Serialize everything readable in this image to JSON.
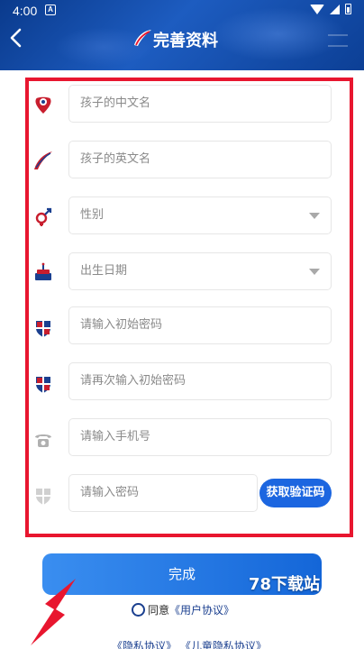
{
  "status": {
    "time": "4:00"
  },
  "header": {
    "title": "完善资料"
  },
  "form": {
    "chinese_name": {
      "placeholder": "孩子的中文名"
    },
    "english_name": {
      "placeholder": "孩子的英文名"
    },
    "gender": {
      "placeholder": "性别"
    },
    "birthday": {
      "placeholder": "出生日期"
    },
    "initial_password": {
      "placeholder": "请输入初始密码"
    },
    "confirm_password": {
      "placeholder": "请再次输入初始密码"
    },
    "phone": {
      "placeholder": "请输入手机号"
    },
    "password": {
      "placeholder": "请输入密码"
    },
    "get_code_label": "获取验证码"
  },
  "submit_label": "完成",
  "watermark": "78下载站",
  "agreement": {
    "prefix": "同意",
    "user_agreement": "《用户协议》"
  },
  "policies": {
    "privacy": "《隐私协议》",
    "child_privacy": "《儿童隐私协议》"
  },
  "colors": {
    "header_blue": "#1d5cc0",
    "accent": "#1c66e0",
    "border_red": "#e8162f"
  }
}
